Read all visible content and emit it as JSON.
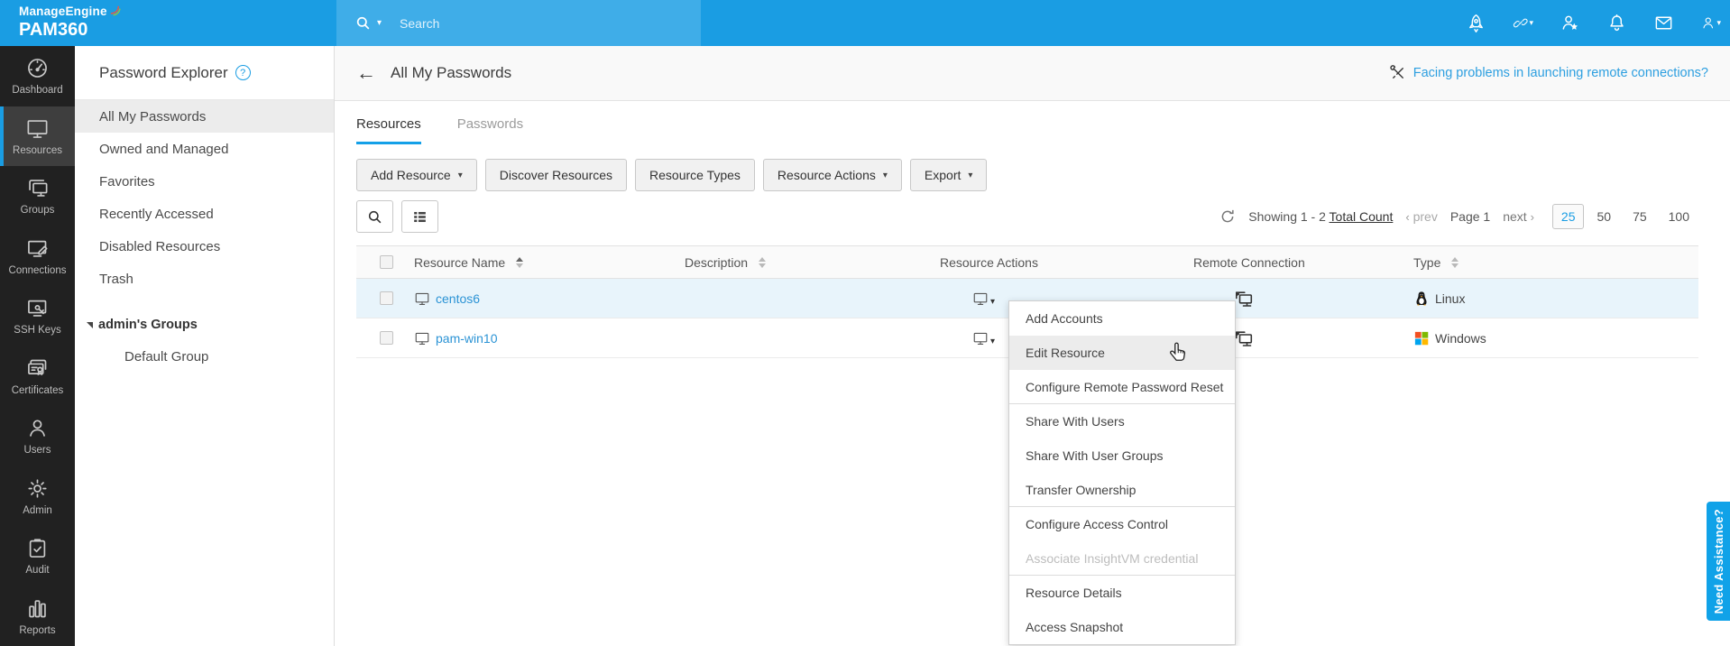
{
  "brand": {
    "name": "ManageEngine",
    "product": "PAM360"
  },
  "topbar": {
    "search_placeholder": "Search",
    "icons": [
      "rocket-icon",
      "link-icon",
      "user-star-icon",
      "bell-icon",
      "mail-icon",
      "user-icon"
    ]
  },
  "sidebar": {
    "items": [
      {
        "id": "dashboard",
        "label": "Dashboard",
        "icon": "gauge",
        "active": false
      },
      {
        "id": "resources",
        "label": "Resources",
        "icon": "monitor",
        "active": true
      },
      {
        "id": "groups",
        "label": "Groups",
        "icon": "monitors",
        "active": false
      },
      {
        "id": "connections",
        "label": "Connections",
        "icon": "monitor-pen",
        "active": false
      },
      {
        "id": "ssh-keys",
        "label": "SSH Keys",
        "icon": "monitor-key",
        "active": false
      },
      {
        "id": "certificates",
        "label": "Certificates",
        "icon": "certificate",
        "active": false
      },
      {
        "id": "users",
        "label": "Users",
        "icon": "user",
        "active": false
      },
      {
        "id": "admin",
        "label": "Admin",
        "icon": "gear",
        "active": false
      },
      {
        "id": "audit",
        "label": "Audit",
        "icon": "clipboard",
        "active": false
      },
      {
        "id": "reports",
        "label": "Reports",
        "icon": "bars",
        "active": false
      }
    ]
  },
  "explorer": {
    "title": "Password Explorer",
    "items": [
      {
        "label": "All My Passwords",
        "active": true
      },
      {
        "label": "Owned and Managed",
        "active": false
      },
      {
        "label": "Favorites",
        "active": false
      },
      {
        "label": "Recently Accessed",
        "active": false
      },
      {
        "label": "Disabled Resources",
        "active": false
      },
      {
        "label": "Trash",
        "active": false
      }
    ],
    "group": {
      "label": "admin's Groups",
      "children": [
        {
          "label": "Default Group"
        }
      ]
    }
  },
  "header": {
    "title": "All My Passwords",
    "help_link": "Facing problems in launching remote connections?"
  },
  "tabs": [
    {
      "label": "Resources",
      "active": true
    },
    {
      "label": "Passwords",
      "active": false
    }
  ],
  "toolbar": {
    "buttons": [
      {
        "label": "Add Resource",
        "dropdown": true
      },
      {
        "label": "Discover Resources",
        "dropdown": false
      },
      {
        "label": "Resource Types",
        "dropdown": false
      },
      {
        "label": "Resource Actions",
        "dropdown": true
      },
      {
        "label": "Export",
        "dropdown": true
      }
    ]
  },
  "pagination": {
    "showing": "Showing 1 - 2",
    "total_link": "Total Count",
    "prev_label": "prev",
    "page_label": "Page 1",
    "next_label": "next",
    "page_sizes": [
      "25",
      "50",
      "75",
      "100"
    ],
    "active_size": "25"
  },
  "table": {
    "columns": [
      {
        "label": "Resource Name",
        "sort": "active"
      },
      {
        "label": "Description",
        "sort": "both"
      },
      {
        "label": "Resource Actions",
        "sort": null
      },
      {
        "label": "Remote Connection",
        "sort": null
      },
      {
        "label": "Type",
        "sort": "both"
      }
    ],
    "rows": [
      {
        "name": "centos6",
        "description": "",
        "type": "Linux",
        "type_icon": "tux",
        "selected": true
      },
      {
        "name": "pam-win10",
        "description": "",
        "type": "Windows",
        "type_icon": "windows",
        "selected": false
      }
    ]
  },
  "context_menu": {
    "items": [
      {
        "label": "Add Accounts"
      },
      {
        "label": "Edit Resource",
        "hover": true
      },
      {
        "label": "Configure Remote Password Reset",
        "divider_after": true
      },
      {
        "label": "Share With Users"
      },
      {
        "label": "Share With User Groups"
      },
      {
        "label": "Transfer Ownership",
        "divider_after": true
      },
      {
        "label": "Configure Access Control"
      },
      {
        "label": "Associate InsightVM credential",
        "disabled": true,
        "divider_after": true
      },
      {
        "label": "Resource Details"
      },
      {
        "label": "Access Snapshot"
      }
    ]
  },
  "assist_tab": {
    "label": "Need Assistance?"
  },
  "colors": {
    "topbar": "#1a9de3",
    "accent": "#1a9de3",
    "link": "#2d9fe0",
    "row_selected": "#e8f4fb"
  }
}
